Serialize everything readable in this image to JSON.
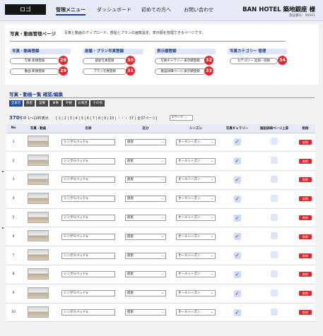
{
  "header": {
    "logo": "ロゴ",
    "nav": [
      "管理メニュー",
      "ダッシュボード",
      "初めての方へ",
      "お問い合わせ"
    ],
    "hotel_name": "BAN HOTEL 築地銀座 様",
    "facility_no": "施設番号：00001"
  },
  "intro": {
    "title": "写真・動画管理ページ",
    "description": "写真と動画のアップロード、部屋とプランの画像設定、表示順を管理できるページです。"
  },
  "groups": [
    {
      "title": "写真・動画登録",
      "buttons": [
        {
          "label": "写真 新規登録",
          "badge": "28"
        },
        {
          "label": "動画 新規登録",
          "badge": "29"
        }
      ]
    },
    {
      "title": "部屋・プラン写真登録",
      "buttons": [
        {
          "label": "部屋写真登録",
          "badge": "30"
        },
        {
          "label": "プラン写真登録",
          "badge": "31"
        }
      ]
    },
    {
      "title": "表示順登録",
      "buttons": [
        {
          "label": "写真ギャラリー 表示順登録",
          "badge": "32"
        },
        {
          "label": "施設詳細ページ 表示順登録",
          "badge": "33"
        }
      ]
    },
    {
      "title": "写真カテゴリー 管理",
      "buttons": [
        {
          "label": "カテゴリー 追加・削除",
          "badge": "34"
        }
      ]
    }
  ],
  "list": {
    "title": "写真・動画一覧 確認/編集",
    "tabs": [
      "全表示",
      "部屋",
      "設備",
      "食事",
      "外観",
      "お風呂",
      "その他"
    ],
    "count": "370",
    "count_suffix": "件中",
    "range": "1〜10件表示",
    "pagination": "[ 1 | 2 | 3 | 4 | 5 | 6 | 7 | 8 | 9 | 10 | ・・・ 37 | 全37ページ]",
    "per_page": "1ページ",
    "columns": [
      "No",
      "写真・動画",
      "名称",
      "区分",
      "シーズン",
      "写真ギャラリー",
      "施設詳細ページ上部",
      "削除"
    ],
    "rows": [
      {
        "no": "1",
        "name": "シングルベッドa",
        "category": "部屋",
        "season": "オールシーズン",
        "gallery": true,
        "top": false,
        "delete": "削除"
      },
      {
        "no": "2",
        "name": "シングルベッドa",
        "category": "部屋",
        "season": "オールシーズン",
        "gallery": true,
        "top": false,
        "delete": "削除"
      },
      {
        "no": "3",
        "name": "シングルベッドa",
        "category": "部屋",
        "season": "オールシーズン",
        "gallery": true,
        "top": false,
        "delete": "削除"
      },
      {
        "no": "4",
        "name": "シングルベッドa",
        "category": "部屋",
        "season": "オールシーズン",
        "gallery": true,
        "top": false,
        "delete": "削除"
      },
      {
        "no": "5",
        "name": "シングルベッドa",
        "category": "部屋",
        "season": "オールシーズン",
        "gallery": true,
        "top": false,
        "delete": "削除"
      },
      {
        "no": "6",
        "name": "シングルベッドa",
        "category": "部屋",
        "season": "オールシーズン",
        "gallery": true,
        "top": false,
        "delete": "削除"
      },
      {
        "no": "7",
        "name": "シングルベッドa",
        "category": "部屋",
        "season": "オールシーズン",
        "gallery": true,
        "top": false,
        "delete": "削除"
      },
      {
        "no": "8",
        "name": "シングルベッドa",
        "category": "部屋",
        "season": "オールシーズン",
        "gallery": true,
        "top": false,
        "delete": "削除"
      },
      {
        "no": "9",
        "name": "シングルベッドa",
        "category": "部屋",
        "season": "オールシーズン",
        "gallery": true,
        "top": false,
        "delete": "削除"
      },
      {
        "no": "10",
        "name": "シングルベッドa",
        "category": "部屋",
        "season": "オールシーズン",
        "gallery": true,
        "top": false,
        "delete": "削除"
      }
    ]
  },
  "colors": {
    "accent": "#1f3a93",
    "badge": "#e8262d",
    "delete": "#e0252d"
  },
  "icons": {
    "checkbox": "check-icon",
    "select": "chevron-down-icon"
  }
}
